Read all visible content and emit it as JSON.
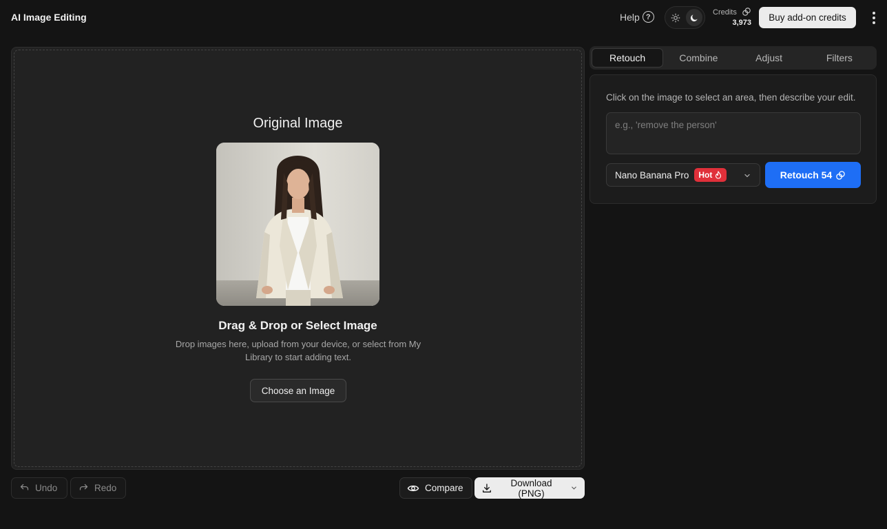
{
  "header": {
    "title": "AI Image Editing",
    "help_label": "Help",
    "help_icon_glyph": "?",
    "credits_label": "Credits",
    "credits_value": "3,973",
    "buy_label": "Buy add-on credits",
    "theme": {
      "light_icon": "sun-icon",
      "dark_icon": "moon-icon",
      "active": "dark"
    }
  },
  "canvas": {
    "title": "Original Image",
    "drop_title": "Drag & Drop or Select Image",
    "drop_subtitle": "Drop images here, upload from your device, or select from My Library to start adding text.",
    "choose_label": "Choose an Image"
  },
  "toolbar": {
    "undo_label": "Undo",
    "redo_label": "Redo",
    "compare_label": "Compare",
    "download_label": "Download (PNG)"
  },
  "tabs": [
    {
      "label": "Retouch",
      "active": true
    },
    {
      "label": "Combine",
      "active": false
    },
    {
      "label": "Adjust",
      "active": false
    },
    {
      "label": "Filters",
      "active": false
    }
  ],
  "edit": {
    "hint": "Click on the image to select an area, then describe your edit.",
    "placeholder": "e.g., 'remove the person'",
    "value": "",
    "model_name": "Nano Banana Pro",
    "model_badge": "Hot",
    "action_label": "Retouch 54"
  },
  "colors": {
    "background": "#141414",
    "panel": "#222222",
    "accent": "#1e6ef5",
    "hot_badge": "#e0303a",
    "primary_button": "#ececec"
  }
}
